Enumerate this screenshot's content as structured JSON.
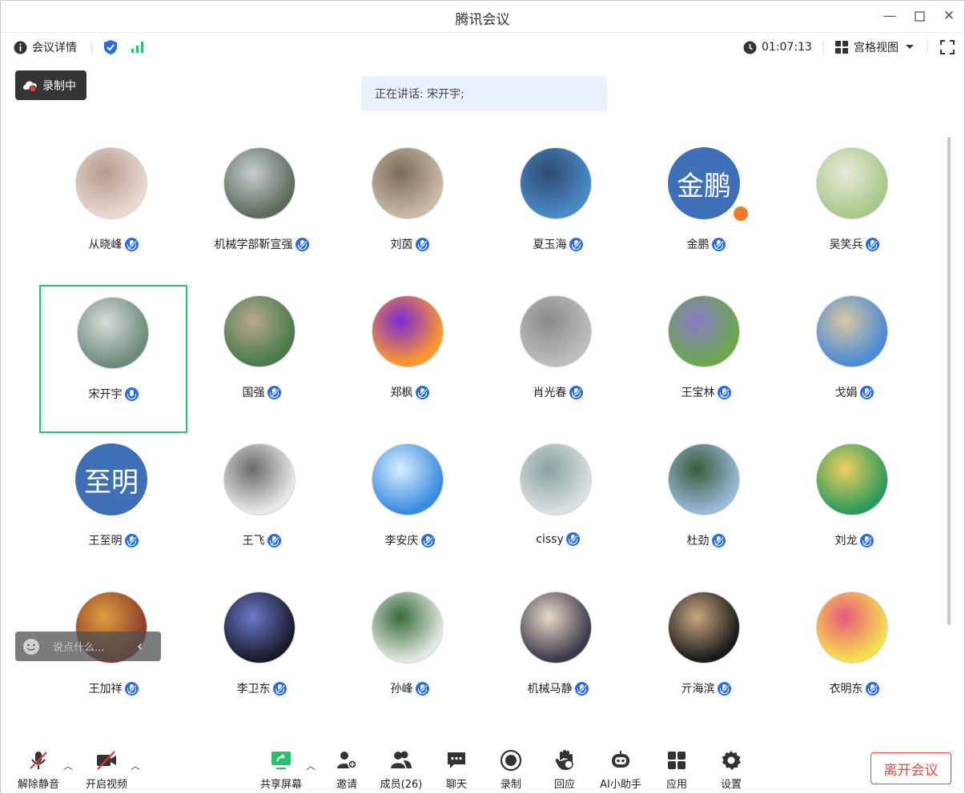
{
  "window": {
    "title": "腾讯会议"
  },
  "toolbar": {
    "info_label": "会议详情",
    "timer": "01:07:13",
    "view_label": "宫格视图"
  },
  "recording": {
    "label": "录制中"
  },
  "speaking": {
    "text": "正在讲话: 宋开宇;"
  },
  "participants": [
    {
      "name": "从晓峰"
    },
    {
      "name": "机械学部靳宣强"
    },
    {
      "name": "刘茵"
    },
    {
      "name": "夏玉海"
    },
    {
      "name": "金鹏",
      "avatar_text": "金鹏"
    },
    {
      "name": "吴笑兵"
    },
    {
      "name": "宋开宇"
    },
    {
      "name": "国强"
    },
    {
      "name": "郑枫"
    },
    {
      "name": "肖光春"
    },
    {
      "name": "王宝林"
    },
    {
      "name": "戈娟"
    },
    {
      "name": "王至明",
      "avatar_text": "至明"
    },
    {
      "name": "王飞"
    },
    {
      "name": "李安庆"
    },
    {
      "name": "cissy"
    },
    {
      "name": "杜劲"
    },
    {
      "name": "刘龙"
    },
    {
      "name": "王加祥"
    },
    {
      "name": "李卫东"
    },
    {
      "name": "孙峰"
    },
    {
      "name": "机械马静"
    },
    {
      "name": "亓海滨"
    },
    {
      "name": "衣明东"
    }
  ],
  "chat": {
    "placeholder": "说点什么..."
  },
  "bottom": {
    "unmute": "解除静音",
    "start_video": "开启视频",
    "share": "共享屏幕",
    "invite": "邀请",
    "members": "成员(26)",
    "chat": "聊天",
    "record": "录制",
    "react": "回应",
    "ai": "AI小助手",
    "apps": "应用",
    "settings": "设置",
    "leave": "离开会议"
  },
  "colors": {
    "accent": "#2a6de3",
    "active_border": "#25c26e",
    "leave": "#e14a3a",
    "text_avatar": "#3f6fb6"
  }
}
